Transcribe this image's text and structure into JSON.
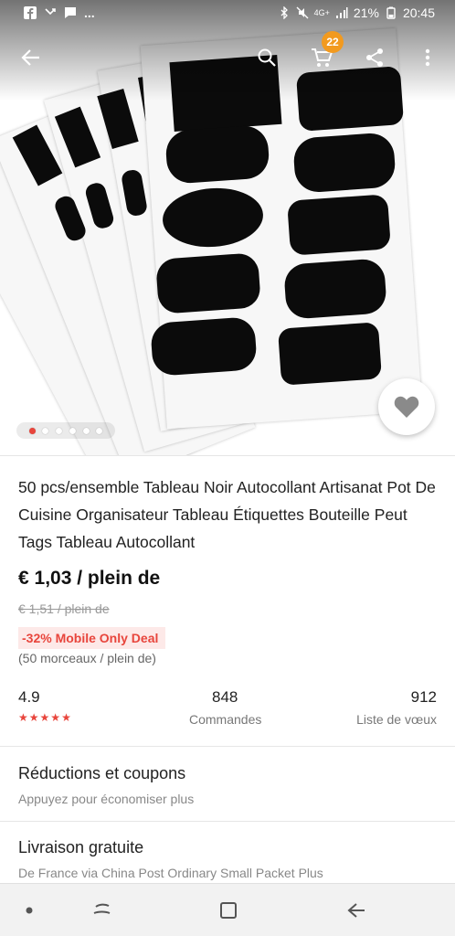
{
  "status_bar": {
    "battery": "21%",
    "time": "20:45",
    "network": "4G+"
  },
  "toolbar": {
    "cart_count": "22"
  },
  "gallery": {
    "image_count": 6,
    "active_index": 0
  },
  "product": {
    "title": "50 pcs/ensemble Tableau Noir Autocollant Artisanat Pot De Cuisine Organisateur Tableau Étiquettes Bouteille Peut Tags Tableau Autocollant",
    "price": "€ 1,03 / plein de",
    "old_price": "€ 1,51 / plein de",
    "deal": "-32% Mobile Only Deal",
    "unit": "(50 morceaux / plein de)"
  },
  "stats": {
    "rating": "4.9",
    "orders": "848",
    "orders_label": "Commandes",
    "wishlist": "912",
    "wishlist_label": "Liste de vœux"
  },
  "sections": {
    "coupons_title": "Réductions et coupons",
    "coupons_sub": "Appuyez pour économiser plus",
    "shipping_title": "Livraison gratuite",
    "shipping_sub": "De France via China Post Ordinary Small Packet Plus"
  },
  "colors": {
    "accent": "#e8453c",
    "badge": "#f29a1f"
  }
}
